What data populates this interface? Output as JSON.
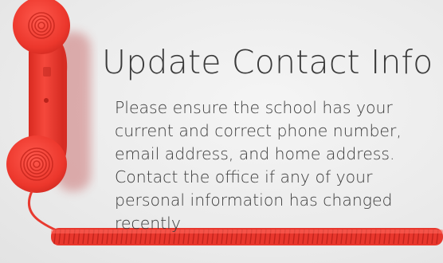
{
  "headline": "Update Contact Info",
  "body": "Please ensure the school has your current and correct phone number, email address, and home address. Contact the office if any of your personal information has changed recently",
  "colors": {
    "background": "#ececec",
    "phone_red": "#ee3a2f",
    "text": "#3a3a3a"
  },
  "image": {
    "subject": "red retro telephone handset with coiled cord"
  }
}
